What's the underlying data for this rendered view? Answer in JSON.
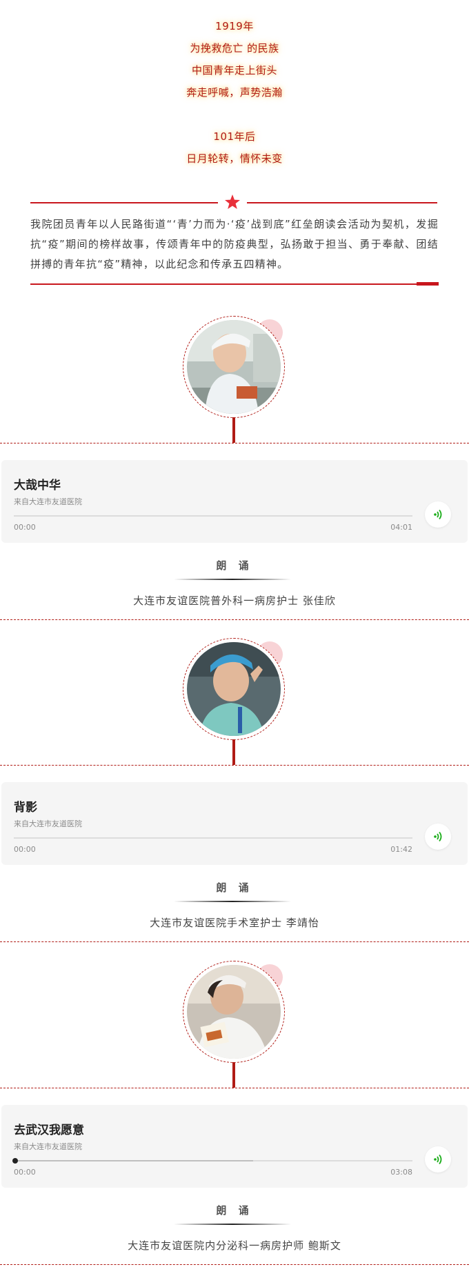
{
  "intro": {
    "lines": [
      "1919年",
      "为挽救危亡 的民族",
      "中国青年走上街头",
      "奔走呼喊，声势浩瀚",
      "101年后",
      "日月轮转，情怀未变"
    ],
    "paragraph": "我院团员青年以人民路街道“‘青’力而为·‘疫’战到底”红垒朗读会活动为契机，发掘抗“疫”期间的榜样故事，传颂青年中的防疫典型，弘扬敢于担当、勇于奉献、团结拼搏的青年抗“疫”精神，以此纪念和传承五四精神。"
  },
  "colors": {
    "accent": "#c8161d",
    "card_bg": "#f5f5f5",
    "play_green": "#1aad19"
  },
  "icons": {
    "star": "star-icon",
    "play": "audio-wave-icon"
  },
  "sections": [
    {
      "audio": {
        "title": "大哉中华",
        "source": "来自大连市友道医院",
        "start": "00:00",
        "end": "04:01",
        "progress": 0
      },
      "recite_label": "朗 诵",
      "reader": "大连市友谊医院普外科一病房护士   张佳欣"
    },
    {
      "audio": {
        "title": "背影",
        "source": "来自大连市友道医院",
        "start": "00:00",
        "end": "01:42",
        "progress": 0
      },
      "recite_label": "朗 诵",
      "reader": "大连市友谊医院手术室护士   李靖怡"
    },
    {
      "audio": {
        "title": "去武汉我愿意",
        "source": "来自大连市友道医院",
        "start": "00:00",
        "end": "03:08",
        "progress": 0.6
      },
      "recite_label": "朗 诵",
      "reader": "大连市友谊医院内分泌科一病房护师   鲍斯文"
    }
  ]
}
